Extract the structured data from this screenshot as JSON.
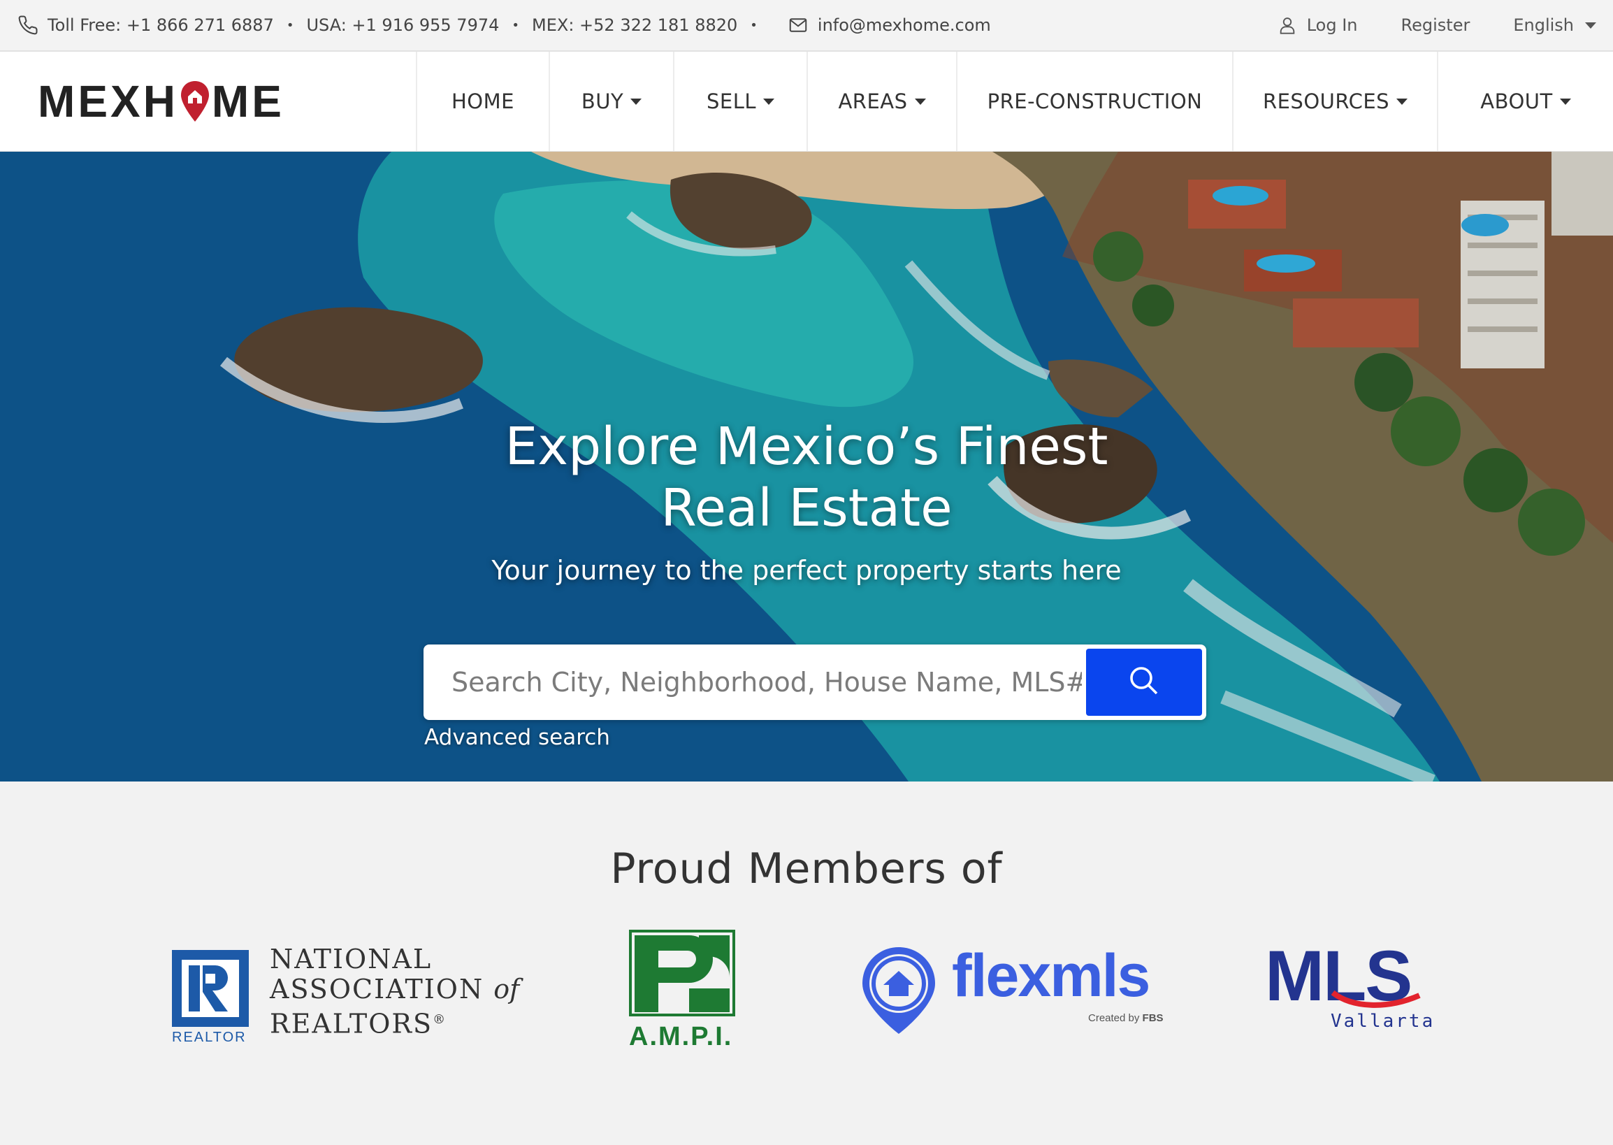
{
  "topbar": {
    "toll_free": "Toll Free: +1 866 271 6887",
    "usa": "USA: +1 916 955 7974",
    "mex": "MEX: +52 322 181 8820",
    "bullet": "•",
    "email": "info@mexhome.com",
    "login": "Log In",
    "register": "Register",
    "language": "English"
  },
  "nav": {
    "logo": {
      "before": "MEXH",
      "after": "ME"
    },
    "items": [
      {
        "label": "HOME",
        "dropdown": false
      },
      {
        "label": "BUY",
        "dropdown": true
      },
      {
        "label": "SELL",
        "dropdown": true
      },
      {
        "label": "AREAS",
        "dropdown": true
      },
      {
        "label": "PRE-CONSTRUCTION",
        "dropdown": false
      },
      {
        "label": "RESOURCES",
        "dropdown": true
      },
      {
        "label": "ABOUT",
        "dropdown": true
      }
    ]
  },
  "hero": {
    "title_line1": "Explore Mexico’s Finest",
    "title_line2": "Real Estate",
    "subtitle": "Your journey to the perfect property starts here",
    "search_placeholder": "Search City, Neighborhood, House Name, MLS#",
    "advanced_search": "Advanced search"
  },
  "members": {
    "title": "Proud Members of",
    "nar": {
      "line1": "NATIONAL",
      "line2": "ASSOCIATION",
      "of": "of",
      "line3": "REALTORS",
      "reg": "®",
      "sub": "REALTOR"
    },
    "ampi": {
      "label": "A.M.P.I."
    },
    "flexmls": {
      "label": "flexmls",
      "sub_prefix": "Created by ",
      "sub_brand": "FBS"
    },
    "mls": {
      "label": "MLS",
      "sub": "Vallarta"
    }
  },
  "colors": {
    "accent_blue": "#0a45ee",
    "logo_red": "#c0202f",
    "ampi_green": "#1e7a33",
    "flex_blue": "#3b5fe0",
    "mls_navy": "#23348f"
  }
}
